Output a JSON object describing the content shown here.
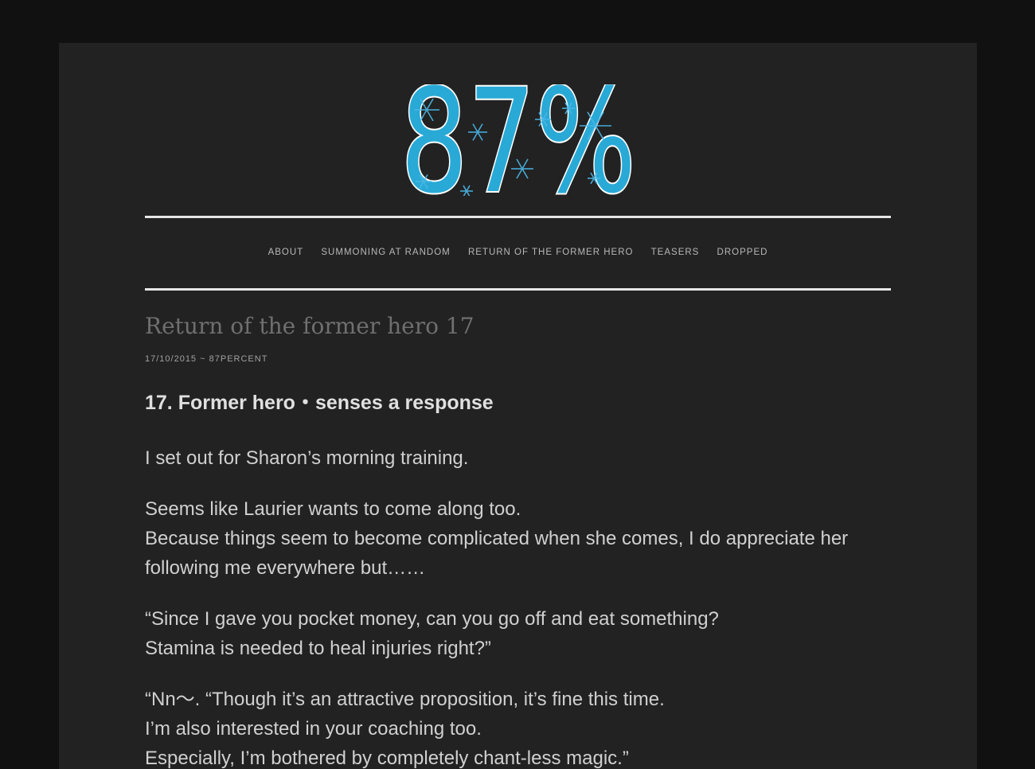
{
  "site": {
    "logo_text": "87%",
    "brand_color": "#29a9d6",
    "logo_outline": "#ffffff",
    "snowflake_color": "#4bb8e8"
  },
  "nav": {
    "items": [
      {
        "label": "ABOUT"
      },
      {
        "label": "SUMMONING AT RANDOM"
      },
      {
        "label": "RETURN OF THE FORMER HERO"
      },
      {
        "label": "TEASERS"
      },
      {
        "label": "DROPPED"
      }
    ]
  },
  "post": {
    "title": "Return of the former hero 17",
    "date": "17/10/2015",
    "separator": "~",
    "author": "87PERCENT",
    "chapter_heading": "17. Former hero・senses a response",
    "paragraphs": [
      {
        "lines": [
          "I set out for Sharon’s morning training."
        ]
      },
      {
        "lines": [
          "Seems like Laurier wants to come along too.",
          "Because things seem to become complicated when she comes, I do appreciate her following me everywhere but……"
        ]
      },
      {
        "lines": [
          "“Since I gave you pocket money, can you go off and eat something?",
          "Stamina is needed to heal injuries right?”"
        ]
      },
      {
        "lines": [
          "“Nn〜. “Though it’s an attractive proposition, it’s fine this time.",
          "I’m also interested in your coaching too.",
          "Especially, I’m bothered by completely chant-less magic.”"
        ]
      }
    ]
  }
}
